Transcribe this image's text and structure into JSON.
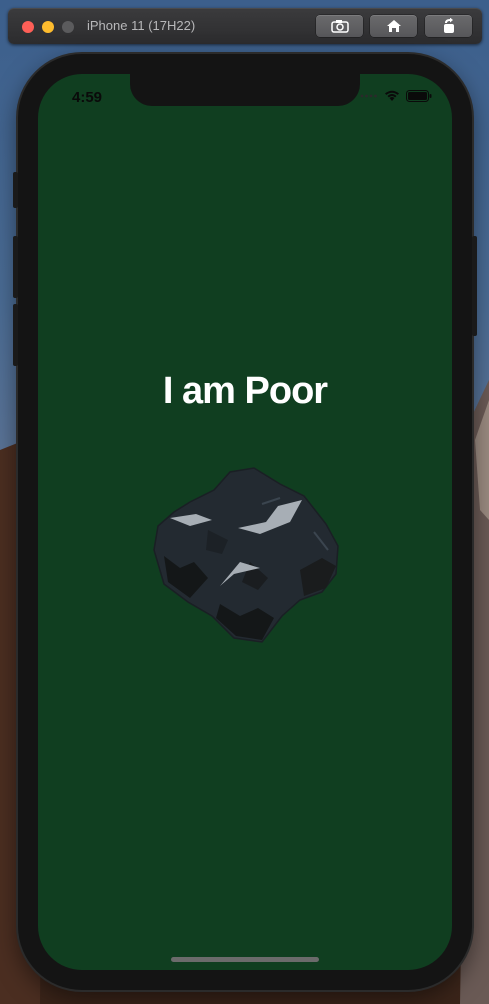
{
  "simulator": {
    "title": "iPhone 11 (17H22)",
    "buttons": [
      {
        "icon": "camera-icon"
      },
      {
        "icon": "home-icon"
      },
      {
        "icon": "rotate-icon"
      }
    ]
  },
  "status_bar": {
    "time": "4:59",
    "icons": [
      "signal-dots-icon",
      "wifi-icon",
      "battery-icon"
    ]
  },
  "app": {
    "title": "I am Poor",
    "image": "coal-icon",
    "background_color": "#103e20",
    "title_color": "#ffffff"
  }
}
